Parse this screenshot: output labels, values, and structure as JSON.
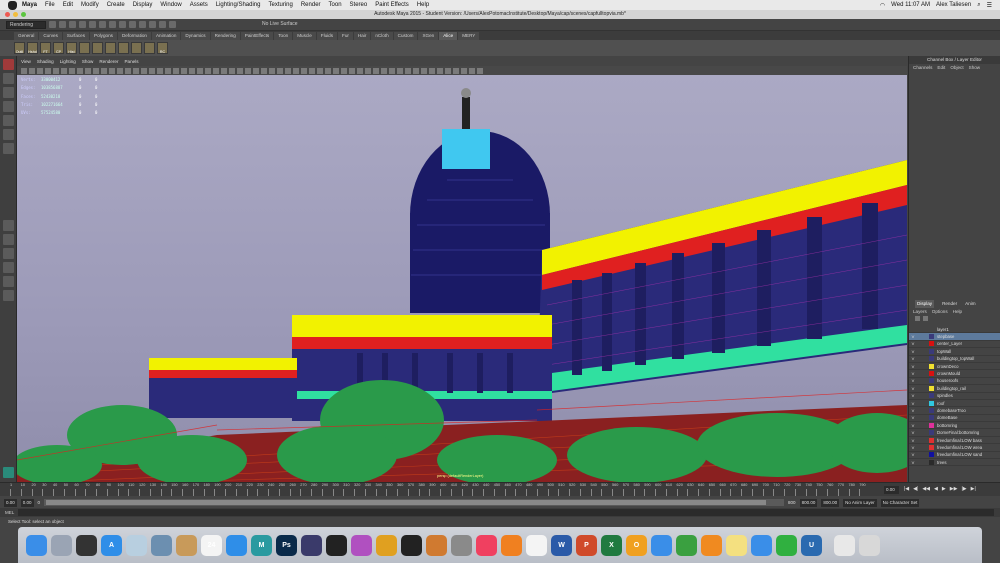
{
  "mac_menu": {
    "app": "Maya",
    "items": [
      "File",
      "Edit",
      "Modify",
      "Create",
      "Display",
      "Window",
      "Assets",
      "Lighting/Shading",
      "Texturing",
      "Render",
      "Toon",
      "Stereo",
      "Paint Effects",
      "Help"
    ],
    "clock": "Wed 11:07 AM",
    "user": "Alex Taliesen"
  },
  "window": {
    "title": "Autodesk Maya 2015 - Student Version: /Users/AlexPotomacInstitute/Desktop/Maya/cap/scenes/capfulltopvia.mb*"
  },
  "status_line": {
    "menu_set": "Rendering",
    "live_surface": "No Live Surface"
  },
  "shelf": {
    "tabs": [
      "General",
      "Curves",
      "Surfaces",
      "Polygons",
      "Deformation",
      "Animation",
      "Dynamics",
      "Rendering",
      "PaintEffects",
      "Toon",
      "Muscle",
      "Fluids",
      "Fur",
      "Hair",
      "nCloth",
      "Custom",
      "XGen",
      "Alice",
      "MERY"
    ],
    "active_tab": "Alice",
    "buttons": [
      "OutlI",
      "Hshd",
      "FT",
      "CP",
      "Hist",
      "",
      "",
      "",
      "",
      "",
      "",
      "RC"
    ]
  },
  "viewport": {
    "menu": [
      "View",
      "Shading",
      "Lighting",
      "Show",
      "Renderer",
      "Panels"
    ],
    "camera_label": "persp (defaultRenderLayer)",
    "hud": [
      {
        "label": "Verts:",
        "value": "33000412",
        "a": "0",
        "b": "0"
      },
      {
        "label": "Edges:",
        "value": "103856887",
        "a": "0",
        "b": "0"
      },
      {
        "label": "Faces:",
        "value": "52430218",
        "a": "0",
        "b": "0"
      },
      {
        "label": "Tris:",
        "value": "102271664",
        "a": "0",
        "b": "0"
      },
      {
        "label": "UVs:",
        "value": "57524580",
        "a": "0",
        "b": "0"
      }
    ]
  },
  "channel_box": {
    "title": "Channel Box / Layer Editor",
    "menu": [
      "Channels",
      "Edit",
      "Object",
      "Show"
    ]
  },
  "layer_editor": {
    "tabs": [
      "Display",
      "Render",
      "Anim"
    ],
    "active_tab": "Display",
    "menu": [
      "Layers",
      "Options",
      "Help"
    ],
    "layers": [
      {
        "vis": "",
        "name": "layer1",
        "color": "#444444",
        "selected": false
      },
      {
        "vis": "V",
        "name": "stepbase",
        "color": "#3a3a7a",
        "selected": true
      },
      {
        "vis": "V",
        "name": "center_Layer",
        "color": "#d81010",
        "selected": false
      },
      {
        "vis": "V",
        "name": "topWall",
        "color": "#3a3a7a",
        "selected": false
      },
      {
        "vis": "V",
        "name": "buildingtop_topWall",
        "color": "#3a3a7a",
        "selected": false
      },
      {
        "vis": "V",
        "name": "crownDeco",
        "color": "#f0e030",
        "selected": false
      },
      {
        "vis": "V",
        "name": "crownMould",
        "color": "#d81010",
        "selected": false
      },
      {
        "vis": "V",
        "name": "houseroofs",
        "color": "#3a3a7a",
        "selected": false
      },
      {
        "vis": "V",
        "name": "buildingtop_rail",
        "color": "#f0e030",
        "selected": false
      },
      {
        "vis": "V",
        "name": "spindles",
        "color": "#3a3a7a",
        "selected": false
      },
      {
        "vis": "V",
        "name": "roof",
        "color": "#30c8e0",
        "selected": false
      },
      {
        "vis": "V",
        "name": "domebaseTroo",
        "color": "#3a3a7a",
        "selected": false
      },
      {
        "vis": "V",
        "name": "domeBase",
        "color": "#3a3a7a",
        "selected": false
      },
      {
        "vis": "V",
        "name": "bottomring",
        "color": "#e0309a",
        "selected": false
      },
      {
        "vis": "V",
        "name": "DomeFinal:bottomring",
        "color": "#3a3a7a",
        "selected": false
      },
      {
        "vis": "V",
        "name": "freedomfinal:LOW bass",
        "color": "#e03030",
        "selected": false
      },
      {
        "vis": "V",
        "name": "freedomfinal:LOW wrea",
        "color": "#e03030",
        "selected": false
      },
      {
        "vis": "V",
        "name": "freedomfinal:LOW sand",
        "color": "#1010a0",
        "selected": false
      },
      {
        "vis": "V",
        "name": "trees",
        "color": "#2a2a2a",
        "selected": false
      }
    ]
  },
  "time_slider": {
    "ticks": [
      "1",
      "10",
      "20",
      "30",
      "40",
      "50",
      "60",
      "70",
      "80",
      "90",
      "100",
      "110",
      "120",
      "130",
      "140",
      "150",
      "160",
      "170",
      "180",
      "190",
      "200",
      "210",
      "220",
      "230",
      "240",
      "250",
      "260",
      "270",
      "280",
      "290",
      "300",
      "310",
      "320",
      "330",
      "340",
      "350",
      "360",
      "370",
      "380",
      "390",
      "400",
      "410",
      "420",
      "430",
      "440",
      "450",
      "460",
      "470",
      "480",
      "490",
      "500",
      "510",
      "520",
      "530",
      "540",
      "550",
      "560",
      "570",
      "580",
      "590",
      "600",
      "610",
      "620",
      "630",
      "640",
      "650",
      "660",
      "670",
      "680",
      "690",
      "700",
      "710",
      "720",
      "730",
      "740",
      "750",
      "760",
      "770",
      "780",
      "790"
    ],
    "current": "0.00",
    "playback": [
      "|◀",
      "◀|",
      "◀◀",
      "◀",
      "▶",
      "▶▶",
      "|▶",
      "▶|"
    ]
  },
  "range_slider": {
    "start": "0.00",
    "start2": "0.00",
    "range_start": "0",
    "range_end": "800",
    "end": "800.00",
    "end2": "800.00",
    "anim_layer": "No Anim Layer",
    "char_set": "No Character Set"
  },
  "command_line": {
    "label": "MEL"
  },
  "help_line": {
    "text": "Select Tool: select an object"
  },
  "dock": {
    "apps": [
      {
        "name": "finder-icon",
        "color": "#3a8ee8",
        "glyph": ""
      },
      {
        "name": "launchpad-icon",
        "color": "#9aa4b4",
        "glyph": ""
      },
      {
        "name": "dashboard-icon",
        "color": "#333333",
        "glyph": ""
      },
      {
        "name": "app-store-icon",
        "color": "#2f8ee8",
        "glyph": "A"
      },
      {
        "name": "preview-icon",
        "color": "#b8cfe0",
        "glyph": ""
      },
      {
        "name": "photo-icon",
        "color": "#6c8fb0",
        "glyph": ""
      },
      {
        "name": "notes-icon",
        "color": "#c89a5a",
        "glyph": ""
      },
      {
        "name": "calendar-icon",
        "color": "#f4f4f4",
        "glyph": "24"
      },
      {
        "name": "safari-icon",
        "color": "#2f8ee8",
        "glyph": ""
      },
      {
        "name": "maya-icon",
        "color": "#2a9aa0",
        "glyph": "M"
      },
      {
        "name": "photoshop-icon",
        "color": "#0a2a4a",
        "glyph": "Ps"
      },
      {
        "name": "imovie-icon",
        "color": "#3a3a6a",
        "glyph": ""
      },
      {
        "name": "final-cut-icon",
        "color": "#222222",
        "glyph": ""
      },
      {
        "name": "motion-icon",
        "color": "#b050c0",
        "glyph": ""
      },
      {
        "name": "compressor-icon",
        "color": "#e0a020",
        "glyph": ""
      },
      {
        "name": "logic-icon",
        "color": "#222222",
        "glyph": ""
      },
      {
        "name": "garageband-icon",
        "color": "#d07a30",
        "glyph": ""
      },
      {
        "name": "settings-icon",
        "color": "#8a8a8a",
        "glyph": ""
      },
      {
        "name": "music-icon",
        "color": "#f04060",
        "glyph": ""
      },
      {
        "name": "books-icon",
        "color": "#f08020",
        "glyph": ""
      },
      {
        "name": "photos-icon",
        "color": "#f4f4f4",
        "glyph": ""
      },
      {
        "name": "word-icon",
        "color": "#2a5aa8",
        "glyph": "W"
      },
      {
        "name": "powerpoint-icon",
        "color": "#d04a2a",
        "glyph": "P"
      },
      {
        "name": "excel-icon",
        "color": "#207a40",
        "glyph": "X"
      },
      {
        "name": "outlook-icon",
        "color": "#f0a020",
        "glyph": "O"
      },
      {
        "name": "keynote-icon",
        "color": "#3a8ee8",
        "glyph": ""
      },
      {
        "name": "numbers-icon",
        "color": "#3aa040",
        "glyph": ""
      },
      {
        "name": "pages-icon",
        "color": "#f08a20",
        "glyph": ""
      },
      {
        "name": "stickies-icon",
        "color": "#f4e080",
        "glyph": ""
      },
      {
        "name": "messages-icon",
        "color": "#3a8ee8",
        "glyph": ""
      },
      {
        "name": "facetime-icon",
        "color": "#30b040",
        "glyph": ""
      },
      {
        "name": "unity-icon",
        "color": "#2a6ab0",
        "glyph": "U"
      },
      {
        "name": "documents-icon",
        "color": "#e8e8e8",
        "glyph": ""
      },
      {
        "name": "trash-icon",
        "color": "#d8d8d8",
        "glyph": ""
      }
    ]
  }
}
